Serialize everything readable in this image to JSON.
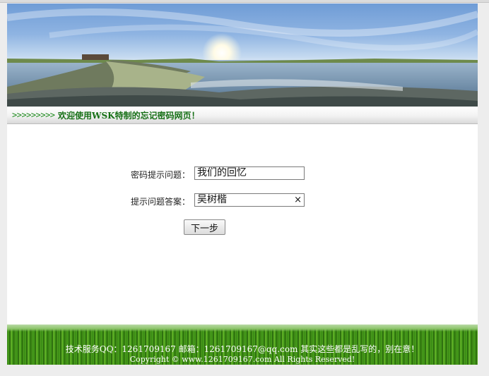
{
  "welcome": {
    "arrows": ">>>>>>>>>",
    "text": "欢迎使用WSK特制的忘记密码网页！"
  },
  "form": {
    "question_label": "密码提示问题：",
    "question_value": "我们的回忆",
    "answer_label": "提示问题答案：",
    "answer_value": "吴树楷",
    "clear_icon": "×",
    "next_button": "下一步"
  },
  "footer": {
    "line1": "技术服务QQ：1261709167 邮箱：1261709167@qq.com 其实这些都是乱写的，别在意！",
    "line2": "Copyright © www.1261709167.com All Rights Reserved!"
  },
  "colors": {
    "welcome_text": "#177017",
    "footer_grass": "#3c8f15"
  }
}
